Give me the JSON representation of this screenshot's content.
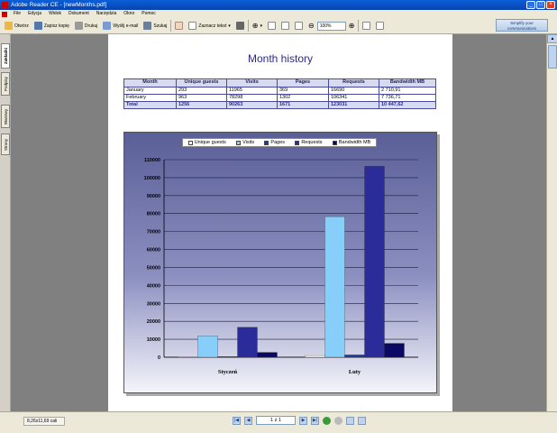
{
  "window": {
    "title": "Adobe Reader CE - [newMonths.pdf]"
  },
  "menubar": {
    "items": [
      "File",
      "Edycja",
      "Widok",
      "Dokument",
      "Narzędzia",
      "Okno",
      "Pomoc"
    ]
  },
  "toolbar": {
    "open_label": "Otwórz",
    "save_copy_label": "Zapisz kopię",
    "print_label": "Drukuj",
    "email_label": "Wyślij e-mail",
    "search_label": "Szukaj",
    "select_text_label": "Zaznacz tekst",
    "zoom_value": "100%",
    "promo_line1": "Simplify your",
    "promo_line2": "communications"
  },
  "nav_tabs": [
    "Zakładki",
    "Podpisy",
    "Warstwy",
    "Strony"
  ],
  "document": {
    "title": "Month history",
    "table": {
      "headers": [
        "Month",
        "Unique guests",
        "Visits",
        "Pages",
        "Requests",
        "Bandwidth MB"
      ],
      "rows": [
        [
          "January",
          "293",
          "11965",
          "369",
          "16690",
          "2 710,91"
        ],
        [
          "February",
          "963",
          "78298",
          "1302",
          "106341",
          "7 736,71"
        ]
      ],
      "total": [
        "Total",
        "1256",
        "90263",
        "1671",
        "123031",
        "10 447,62"
      ]
    }
  },
  "chart_data": {
    "type": "bar",
    "categories": [
      "Styczeń",
      "Luty"
    ],
    "series": [
      {
        "name": "Unique guests",
        "values": [
          293,
          963
        ],
        "color": "#ffffff"
      },
      {
        "name": "Visits",
        "values": [
          11965,
          78298
        ],
        "color": "#87cefa"
      },
      {
        "name": "Pages",
        "values": [
          369,
          1302
        ],
        "color": "#1f3c99"
      },
      {
        "name": "Requests",
        "values": [
          16690,
          106341
        ],
        "color": "#2b2b99"
      },
      {
        "name": "Bandwidth MB",
        "values": [
          2711,
          7737
        ],
        "color": "#0a0a66"
      }
    ],
    "yticks": [
      "0",
      "10000",
      "20000",
      "30000",
      "40000",
      "50000",
      "60000",
      "70000",
      "80000",
      "90000",
      "100000",
      "110000"
    ],
    "ylim": [
      0,
      110000
    ],
    "grid": true,
    "legend": "top"
  },
  "statusbar": {
    "page_size": "8,26x11,69 cali",
    "page_indicator": "1 z 1"
  },
  "colors": {
    "titlebar": "#0a5fd8",
    "chrome": "#ece9d8",
    "doc_bg": "#808080",
    "heading": "#2a2a8a"
  }
}
